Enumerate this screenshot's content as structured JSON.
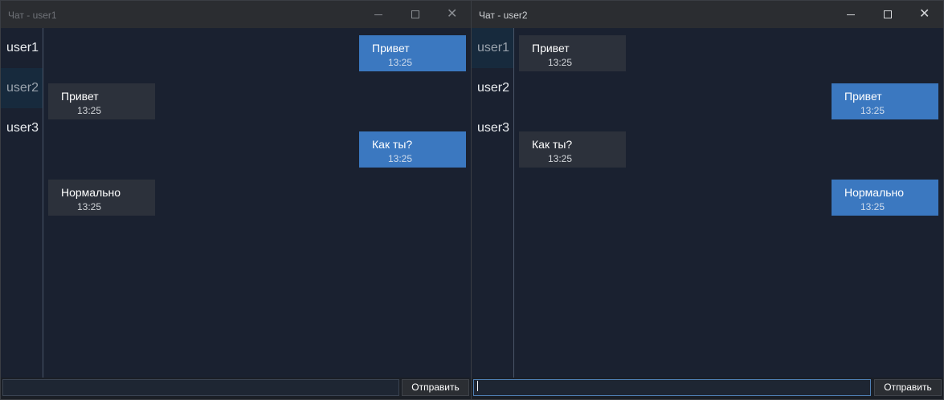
{
  "windows": [
    {
      "title": "Чат - user1",
      "contacts": [
        "user1",
        "user2",
        "user3"
      ],
      "selected_contact": "user2",
      "messages": [
        {
          "text": "Привет",
          "time": "13:25",
          "own": true
        },
        {
          "text": "Привет",
          "time": "13:25",
          "own": false
        },
        {
          "text": "Как ты?",
          "time": "13:25",
          "own": true
        },
        {
          "text": "Нормально",
          "time": "13:25",
          "own": false
        }
      ],
      "input_value": "",
      "send_label": "Отправить"
    },
    {
      "title": "Чат - user2",
      "contacts": [
        "user1",
        "user2",
        "user3"
      ],
      "selected_contact": "user1",
      "messages": [
        {
          "text": "Привет",
          "time": "13:25",
          "own": false
        },
        {
          "text": "Привет",
          "time": "13:25",
          "own": true
        },
        {
          "text": "Как ты?",
          "time": "13:25",
          "own": false
        },
        {
          "text": "Нормально",
          "time": "13:25",
          "own": true
        }
      ],
      "input_value": "",
      "send_label": "Отправить"
    }
  ],
  "icons": {
    "minimize": "minimize-icon",
    "maximize": "maximize-icon",
    "close": "close-icon"
  },
  "colors": {
    "own_bubble": "#3b78c0",
    "other_bubble": "#2c313b",
    "background": "#1a2130"
  }
}
